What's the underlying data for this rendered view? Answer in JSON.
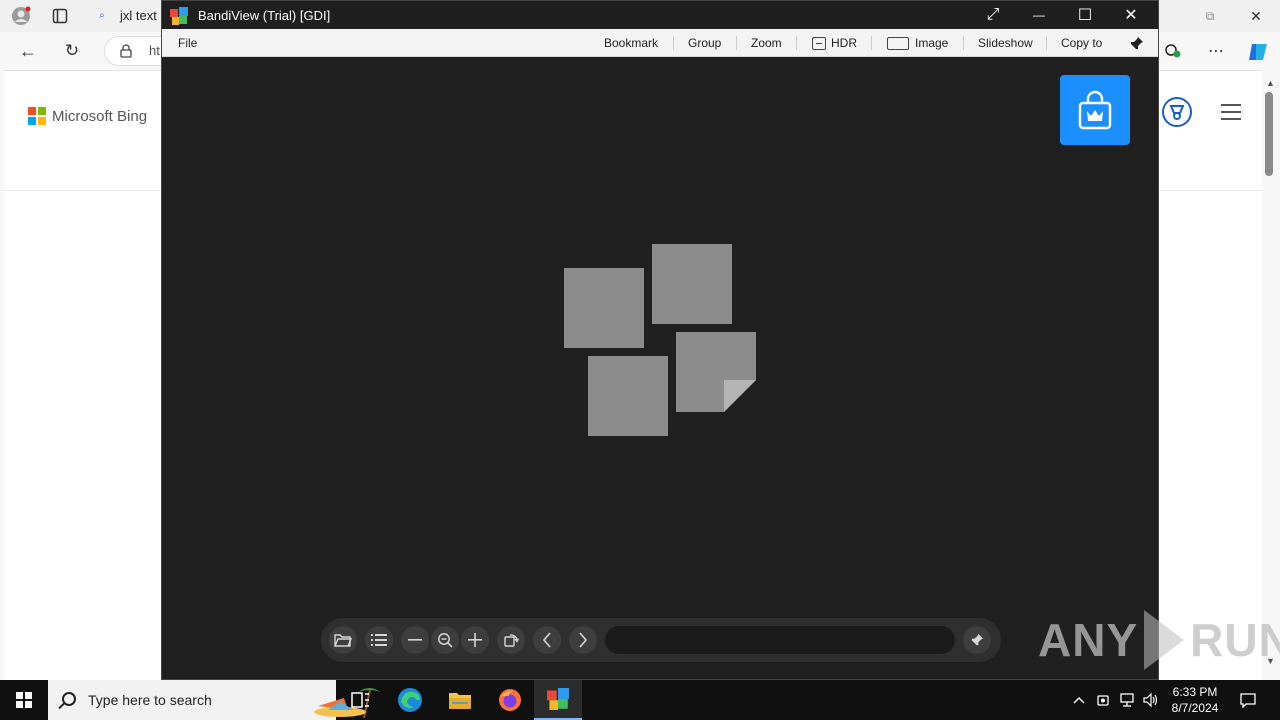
{
  "browser": {
    "tab_title": "jxl text i",
    "address_partial": "ht",
    "bing_logo_text": "Microsoft Bing"
  },
  "bandiview": {
    "title": "BandiView (Trial) [GDI]",
    "menu": {
      "file": "File",
      "bookmark": "Bookmark",
      "group": "Group",
      "zoom": "Zoom",
      "hdr": "HDR",
      "image": "Image",
      "slideshow": "Slideshow",
      "copy_to": "Copy to"
    },
    "window_controls": {
      "fullscreen": "⤢",
      "minimize": "—",
      "maximize": "☐",
      "close": "✕"
    },
    "toolbar_icons": [
      "open-folder-icon",
      "list-icon",
      "zoom-out-icon",
      "zoom-fit-icon",
      "zoom-in-icon",
      "rotate-icon",
      "previous-icon",
      "next-icon",
      "pin-icon"
    ],
    "path_field_value": ""
  },
  "watermark": {
    "left": "ANY",
    "right": "RUN"
  },
  "taskbar": {
    "search_placeholder": "Type here to search",
    "time": "6:33 PM",
    "date": "8/7/2024"
  },
  "colors": {
    "bandiview_canvas": "#202020",
    "shop_button": "#1c8fff",
    "placeholder_tile": "#8c8c8c",
    "taskbar": "#101010"
  }
}
